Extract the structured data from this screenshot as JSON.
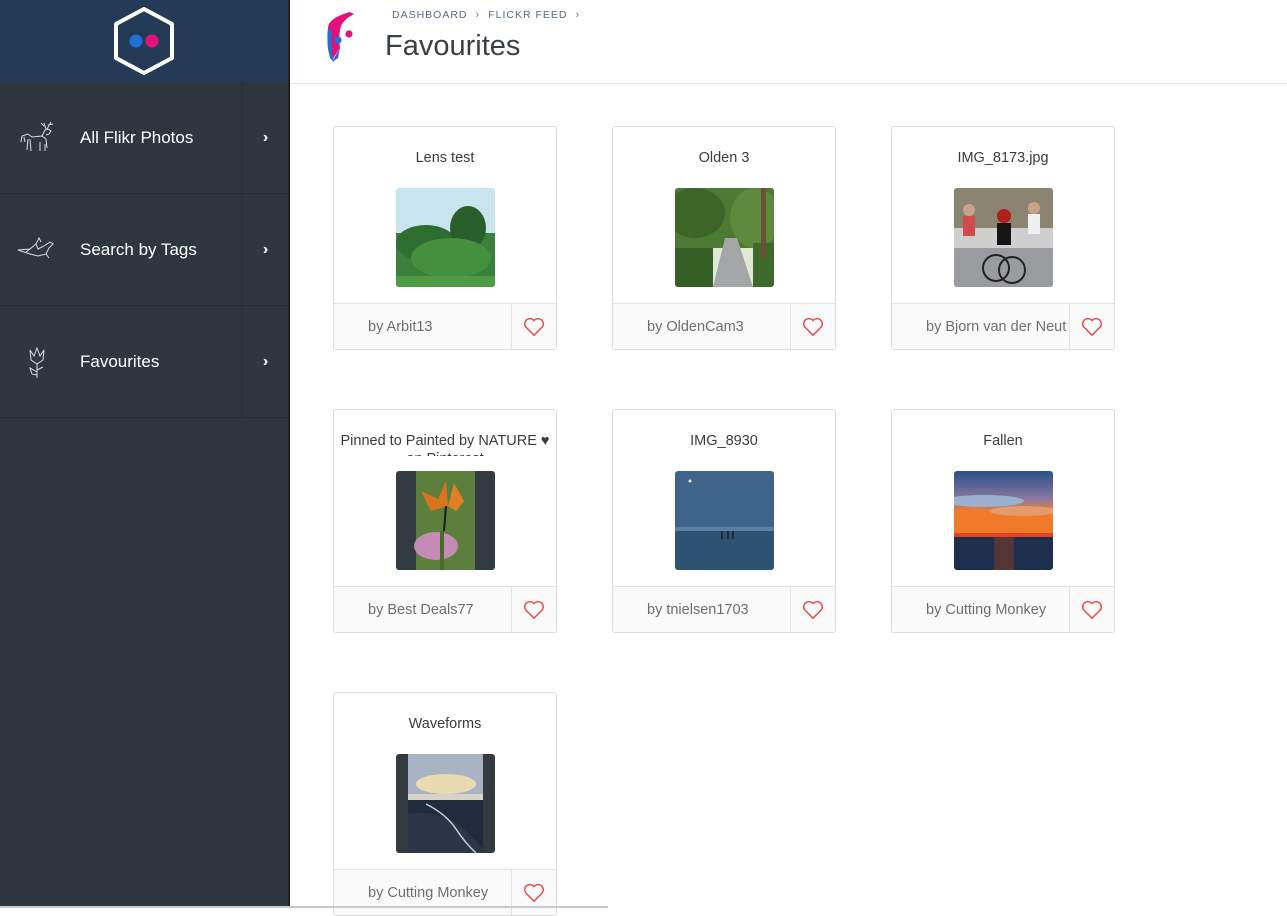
{
  "sidebar": {
    "logo_icon": "flickr-hexagon-logo-icon",
    "items": [
      {
        "label": "All Flikr Photos",
        "icon": "deer-icon"
      },
      {
        "label": "Search by Tags",
        "icon": "bird-icon"
      },
      {
        "label": "Favourites",
        "icon": "tulip-icon"
      }
    ]
  },
  "header": {
    "breadcrumb": [
      "DASHBOARD",
      "FLICKR FEED"
    ],
    "title": "Favourites"
  },
  "cards": [
    {
      "title": "Lens test",
      "author": "by Arbit13"
    },
    {
      "title": "Olden 3",
      "author": "by OldenCam3"
    },
    {
      "title": "IMG_8173.jpg",
      "author": "by Bjorn van der Neut"
    },
    {
      "title": "Pinned to Painted by NATURE ♥ on Pinterest",
      "author": "by Best Deals77"
    },
    {
      "title": "IMG_8930",
      "author": "by tnielsen1703"
    },
    {
      "title": "Fallen",
      "author": "by Cutting Monkey"
    },
    {
      "title": "Waveforms",
      "author": "by Cutting Monkey"
    }
  ],
  "colors": {
    "sidebar_bg": "#2e3640",
    "sidebar_logo_bg": "#233b57",
    "flickr_blue": "#1f6fd6",
    "flickr_pink": "#e3117a",
    "heart": "#e84a4f"
  }
}
